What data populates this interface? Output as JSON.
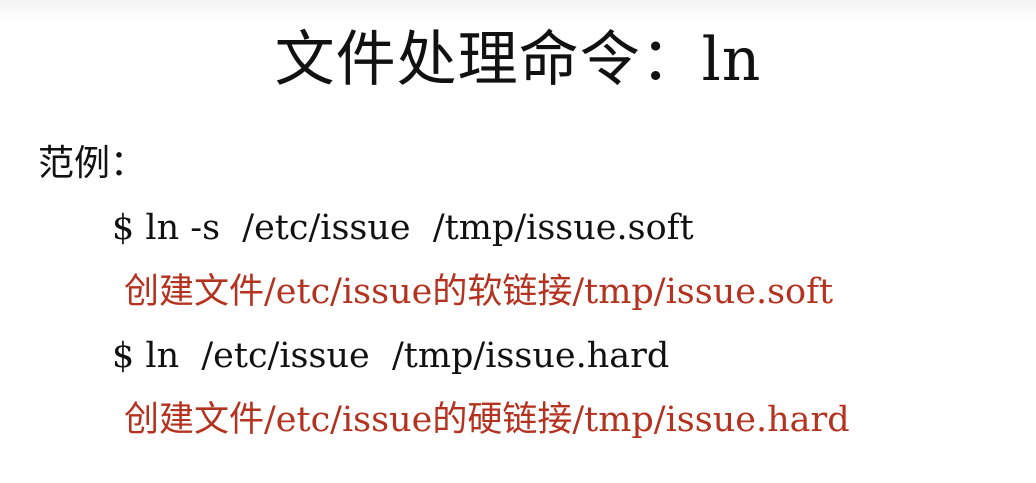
{
  "slide": {
    "title": "文件处理命令：ln",
    "section_label": "范例：",
    "examples": [
      {
        "command": "$ ln -s  /etc/issue  /tmp/issue.soft",
        "description": "创建文件/etc/issue的软链接/tmp/issue.soft"
      },
      {
        "command": "$ ln  /etc/issue  /tmp/issue.hard",
        "description": "创建文件/etc/issue的硬链接/tmp/issue.hard"
      }
    ]
  },
  "colors": {
    "text": "#111111",
    "description": "#b43220",
    "background": "#ffffff"
  }
}
